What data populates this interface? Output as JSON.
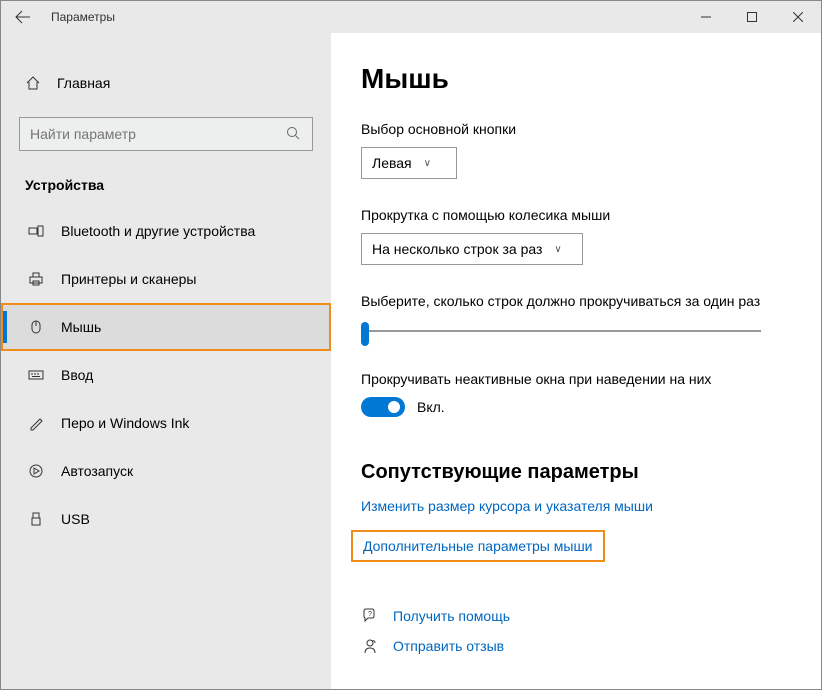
{
  "titlebar": {
    "title": "Параметры"
  },
  "home": {
    "label": "Главная"
  },
  "search": {
    "placeholder": "Найти параметр"
  },
  "category": "Устройства",
  "sidebar": {
    "items": [
      {
        "label": "Bluetooth и другие устройства"
      },
      {
        "label": "Принтеры и сканеры"
      },
      {
        "label": "Мышь"
      },
      {
        "label": "Ввод"
      },
      {
        "label": "Перо и Windows Ink"
      },
      {
        "label": "Автозапуск"
      },
      {
        "label": "USB"
      }
    ]
  },
  "main": {
    "title": "Мышь",
    "primary_button": {
      "label": "Выбор основной кнопки",
      "value": "Левая"
    },
    "scroll_wheel": {
      "label": "Прокрутка с помощью колесика мыши",
      "value": "На несколько строк за раз"
    },
    "lines_label": "Выберите, сколько строк должно прокручиваться за один раз",
    "inactive": {
      "label": "Прокручивать неактивные окна при наведении на них",
      "state": "Вкл."
    },
    "related": {
      "title": "Сопутствующие параметры",
      "link1": "Изменить размер курсора и указателя мыши",
      "link2": "Дополнительные параметры мыши"
    },
    "help": {
      "get_help": "Получить помощь",
      "feedback": "Отправить отзыв"
    }
  }
}
